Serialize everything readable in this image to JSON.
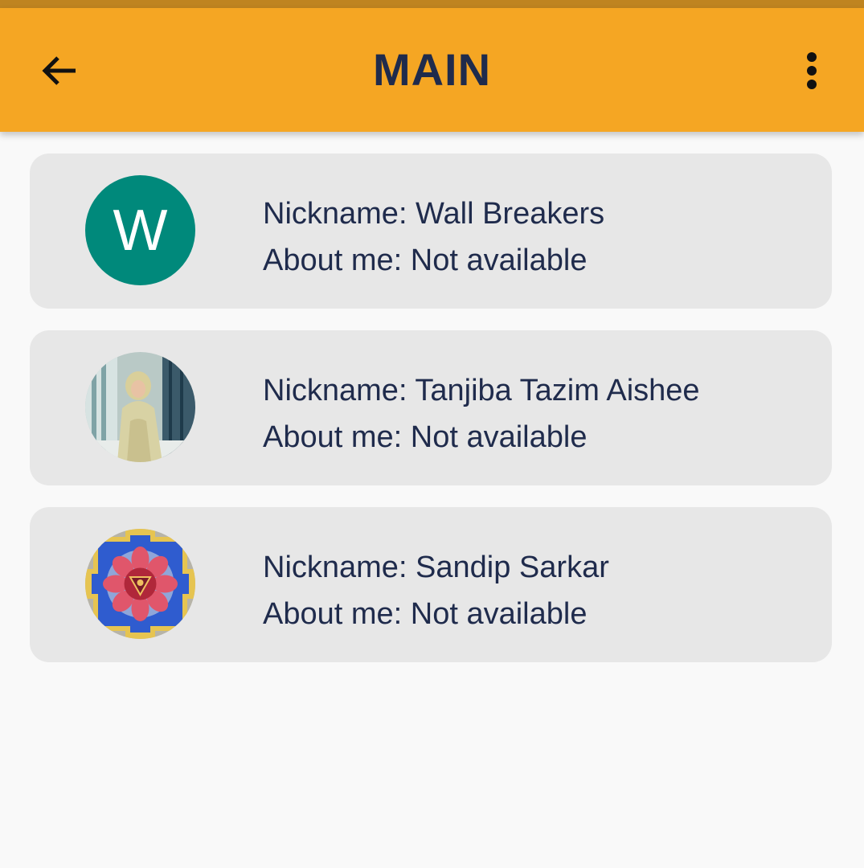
{
  "app_bar": {
    "title": "MAIN",
    "back_icon": "arrow-left-icon",
    "menu_icon": "more-vertical-icon",
    "color": "#f5a623",
    "title_color": "#1f2b4c"
  },
  "users": [
    {
      "nickname_line": "Nickname: Wall Breakers",
      "about_line": "About me: Not available",
      "avatar_letter": "W",
      "avatar_color": "#00897b"
    },
    {
      "nickname_line": "Nickname: Tanjiba Tazim Aishee",
      "about_line": "About me: Not available",
      "avatar_icon": "profile-photo-icon"
    },
    {
      "nickname_line": "Nickname: Sandip Sarkar",
      "about_line": "About me: Not available",
      "avatar_icon": "yantra-mandala-icon"
    }
  ]
}
